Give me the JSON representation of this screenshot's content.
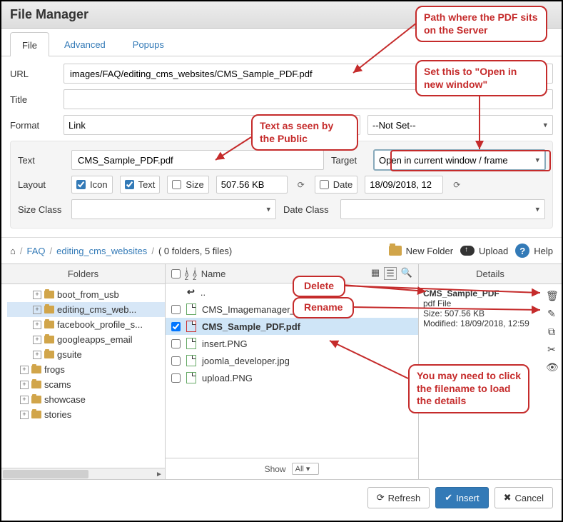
{
  "window": {
    "title": "File Manager"
  },
  "tabs": {
    "file": "File",
    "advanced": "Advanced",
    "popups": "Popups"
  },
  "form": {
    "url_label": "URL",
    "url_value": "images/FAQ/editing_cms_websites/CMS_Sample_PDF.pdf",
    "title_label": "Title",
    "title_value": "",
    "format_label": "Format",
    "format_value": "Link",
    "format_notset": "--Not Set--",
    "text_label": "Text",
    "text_value": "CMS_Sample_PDF.pdf",
    "target_label": "Target",
    "target_value": "Open in current window / frame",
    "layout_label": "Layout",
    "icon_label": "Icon",
    "text_chk_label": "Text",
    "size_label": "Size",
    "size_value": "507.56 KB",
    "date_label": "Date",
    "date_value": "18/09/2018, 12",
    "sizeclass_label": "Size Class",
    "dateclass_label": "Date Class"
  },
  "toolbar": {
    "new_folder": "New Folder",
    "upload": "Upload",
    "help": "Help",
    "crumbs": {
      "root": "FAQ",
      "sub": "editing_cms_websites",
      "count": "( 0 folders, 5 files)"
    }
  },
  "folders": {
    "header": "Folders",
    "items": [
      {
        "indent": 2,
        "label": "boot_from_usb"
      },
      {
        "indent": 2,
        "label": "editing_cms_web...",
        "selected": true
      },
      {
        "indent": 2,
        "label": "facebook_profile_s..."
      },
      {
        "indent": 2,
        "label": "googleapps_email"
      },
      {
        "indent": 2,
        "label": "gsuite"
      },
      {
        "indent": 1,
        "label": "frogs"
      },
      {
        "indent": 1,
        "label": "scams"
      },
      {
        "indent": 1,
        "label": "showcase"
      },
      {
        "indent": 1,
        "label": "stories"
      }
    ]
  },
  "files": {
    "name_header": "Name",
    "parent_row": "..",
    "items": [
      {
        "name": "CMS_Imagemanager_step1.jpg",
        "type": "img"
      },
      {
        "name": "CMS_Sample_PDF.pdf",
        "type": "pdf",
        "selected": true
      },
      {
        "name": "insert.PNG",
        "type": "img"
      },
      {
        "name": "joomla_developer.jpg",
        "type": "img"
      },
      {
        "name": "upload.PNG",
        "type": "img"
      }
    ],
    "show_label": "Show",
    "show_value": "All"
  },
  "details": {
    "header": "Details",
    "name": "CMS_Sample_PDF",
    "type": "pdf File",
    "size": "Size: 507.56 KB",
    "modified": "Modified: 18/09/2018, 12:59"
  },
  "buttons": {
    "refresh": "Refresh",
    "insert": "Insert",
    "cancel": "Cancel"
  },
  "annotations": {
    "path": "Path where the PDF sits on the Server",
    "openwin": "Set this to \"Open in new window\"",
    "publictext": "Text as seen by the Public",
    "delete": "Delete",
    "rename": "Rename",
    "clickload": "You may need to click the filename to load the details"
  }
}
